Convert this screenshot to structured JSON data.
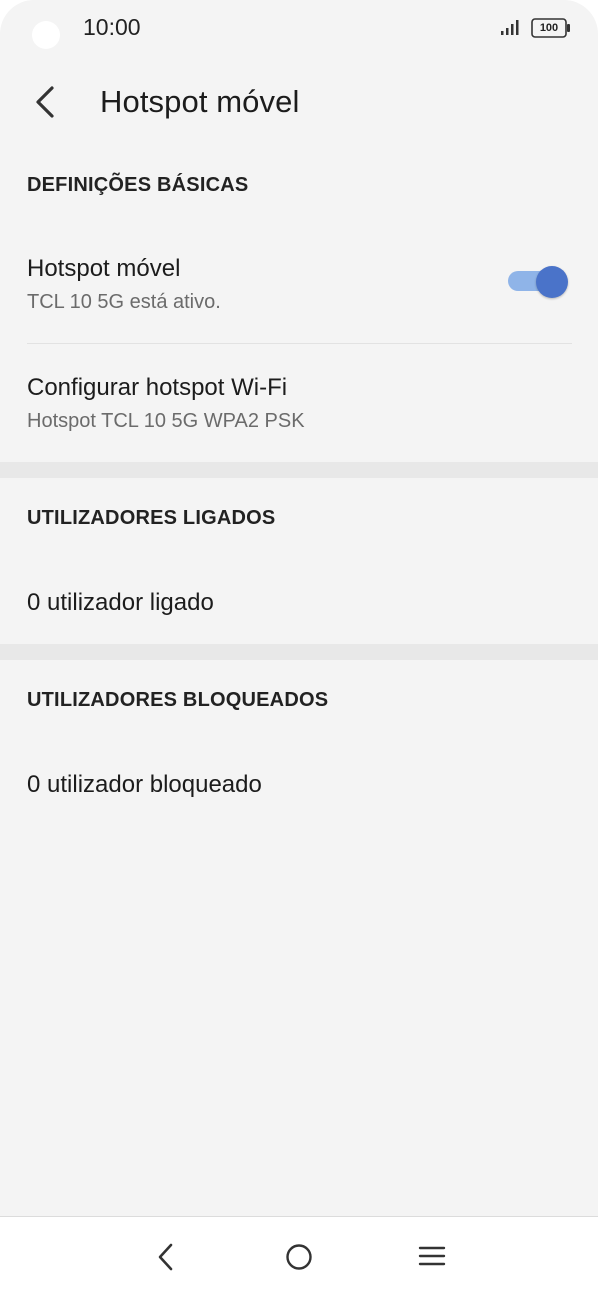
{
  "status_bar": {
    "time": "10:00",
    "battery": "100",
    "icons": [
      "signal-icon",
      "battery-icon"
    ]
  },
  "header": {
    "title": "Hotspot móvel",
    "back_icon": "chevron-left-icon"
  },
  "sections": {
    "basic": {
      "header": "DEFINIÇÕES BÁSICAS",
      "hotspot": {
        "title": "Hotspot móvel",
        "subtitle": "TCL 10 5G está ativo.",
        "enabled": true
      },
      "configure": {
        "title": "Configurar hotspot Wi-Fi",
        "subtitle": "Hotspot TCL 10 5G WPA2 PSK"
      }
    },
    "connected": {
      "header": "UTILIZADORES LIGADOS",
      "item": "0 utilizador ligado"
    },
    "blocked": {
      "header": "UTILIZADORES BLOQUEADOS",
      "item": "0 utilizador bloqueado"
    }
  },
  "colors": {
    "accent": "#4a73c9",
    "accent_track": "#8fb4e8",
    "background": "#f4f4f4"
  },
  "nav_bar": {
    "icons": [
      "back-triangle-icon",
      "home-circle-icon",
      "menu-lines-icon"
    ]
  }
}
